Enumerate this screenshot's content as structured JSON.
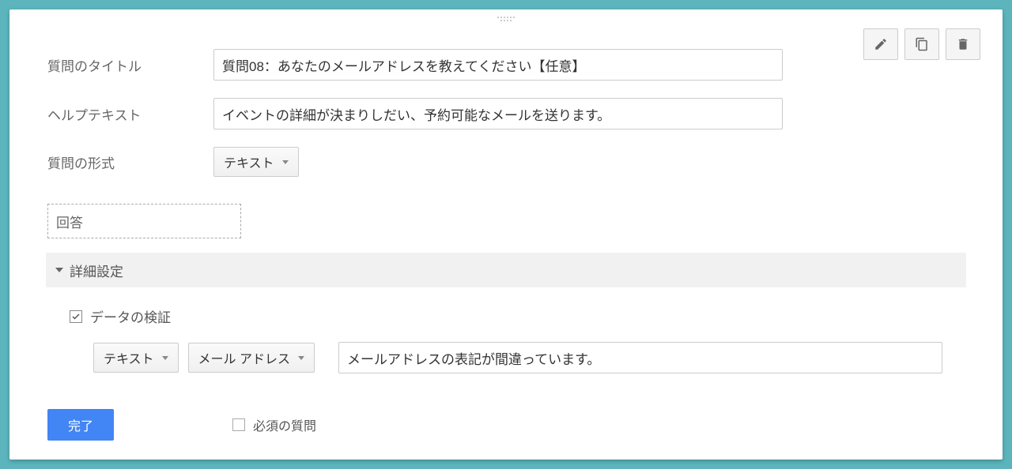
{
  "labels": {
    "title": "質問のタイトル",
    "help": "ヘルプテキスト",
    "type": "質問の形式",
    "answer": "回答",
    "advanced": "詳細設定",
    "validation": "データの検証",
    "required": "必須の質問"
  },
  "fields": {
    "title_value": "質問08：あなたのメールアドレスを教えてください【任意】",
    "help_value": "イベントの詳細が決まりしだい、予約可能なメールを送ります。",
    "type_value": "テキスト",
    "validation_type": "テキスト",
    "validation_subtype": "メール アドレス",
    "validation_error": "メールアドレスの表記が間違っています。"
  },
  "buttons": {
    "done": "完了"
  },
  "state": {
    "validation_checked": true,
    "required_checked": false
  }
}
